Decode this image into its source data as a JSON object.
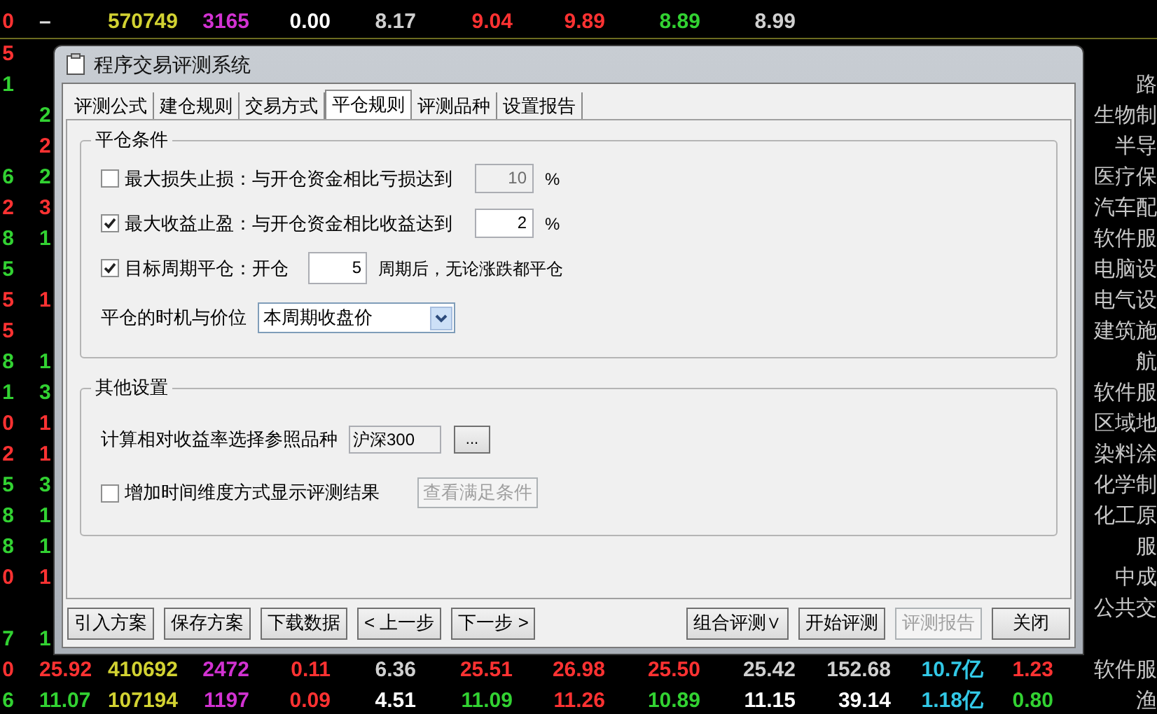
{
  "market_rows": [
    {
      "cells": [
        {
          "text": "0",
          "color": "#ff3232"
        },
        {
          "text": "–",
          "color": "#e0e0e0"
        },
        {
          "text": "570749",
          "color": "#d2d232"
        },
        {
          "text": "3165",
          "color": "#d232d2"
        },
        {
          "text": "0.00",
          "color": "#ffffff"
        },
        {
          "text": "8.17",
          "color": "#d0d0d0"
        },
        {
          "text": "9.04",
          "color": "#ff3232"
        },
        {
          "text": "9.89",
          "color": "#ff3232"
        },
        {
          "text": "8.89",
          "color": "#32d232"
        },
        {
          "text": "8.99",
          "color": "#d0d0d0"
        }
      ]
    },
    {
      "cells": [
        {
          "text": "5",
          "color": "#ff3232"
        }
      ]
    },
    {
      "cells": [
        {
          "text": "1",
          "color": "#32d232"
        }
      ],
      "sector": "路"
    },
    {
      "cells": [
        null,
        {
          "text": "2",
          "color": "#32d232"
        }
      ],
      "sector": "生物制"
    },
    {
      "cells": [
        null,
        {
          "text": "2",
          "color": "#ff3232"
        }
      ],
      "sector": "半导"
    },
    {
      "cells": [
        {
          "text": "6",
          "color": "#32d232"
        },
        {
          "text": "2",
          "color": "#32d232"
        }
      ],
      "sector": "医疗保"
    },
    {
      "cells": [
        {
          "text": "2",
          "color": "#ff3232"
        },
        {
          "text": "3",
          "color": "#ff3232"
        }
      ],
      "sector": "汽车配"
    },
    {
      "cells": [
        {
          "text": "8",
          "color": "#32d232"
        },
        {
          "text": "1",
          "color": "#32d232"
        }
      ],
      "sector": "软件服"
    },
    {
      "cells": [
        {
          "text": "5",
          "color": "#32d232"
        }
      ],
      "sector": "电脑设"
    },
    {
      "cells": [
        {
          "text": "5",
          "color": "#ff3232"
        },
        {
          "text": "1",
          "color": "#ff3232"
        }
      ],
      "sector": "电气设"
    },
    {
      "cells": [
        {
          "text": "5",
          "color": "#ff3232"
        }
      ],
      "sector": "建筑施"
    },
    {
      "cells": [
        {
          "text": "8",
          "color": "#32d232"
        },
        {
          "text": "1",
          "color": "#32d232"
        }
      ],
      "sector": "航"
    },
    {
      "cells": [
        {
          "text": "1",
          "color": "#32d232"
        },
        {
          "text": "3",
          "color": "#32d232"
        }
      ],
      "sector": "软件服"
    },
    {
      "cells": [
        {
          "text": "0",
          "color": "#ff3232"
        },
        {
          "text": "1",
          "color": "#ff3232"
        }
      ],
      "sector": "区域地"
    },
    {
      "cells": [
        {
          "text": "2",
          "color": "#ff3232"
        },
        {
          "text": "1",
          "color": "#ff3232"
        }
      ],
      "sector": "染料涂"
    },
    {
      "cells": [
        {
          "text": "5",
          "color": "#32d232"
        },
        {
          "text": "3",
          "color": "#32d232"
        }
      ],
      "sector": "化学制"
    },
    {
      "cells": [
        {
          "text": "8",
          "color": "#32d232"
        },
        {
          "text": "1",
          "color": "#32d232"
        }
      ],
      "sector": "化工原"
    },
    {
      "cells": [
        {
          "text": "8",
          "color": "#32d232"
        },
        {
          "text": "1",
          "color": "#32d232"
        }
      ],
      "sector": "服"
    },
    {
      "cells": [
        {
          "text": "0",
          "color": "#ff3232"
        },
        {
          "text": "1",
          "color": "#ff3232"
        }
      ],
      "sector": "中成"
    },
    {
      "cells": [],
      "sector": "公共交"
    },
    {
      "cells": [
        {
          "text": "7",
          "color": "#32d232"
        },
        {
          "text": "1",
          "color": "#32d232"
        }
      ]
    },
    {
      "cells": [
        {
          "text": "0",
          "color": "#ff3232"
        },
        {
          "text": "25.92",
          "color": "#ff3232"
        },
        {
          "text": "410692",
          "color": "#d2d232"
        },
        {
          "text": "2472",
          "color": "#d232d2"
        },
        {
          "text": "0.11",
          "color": "#ff3232"
        },
        {
          "text": "6.36",
          "color": "#d0d0d0"
        },
        {
          "text": "25.51",
          "color": "#ff3232"
        },
        {
          "text": "26.98",
          "color": "#ff3232"
        },
        {
          "text": "25.50",
          "color": "#ff3232"
        },
        {
          "text": "25.42",
          "color": "#d0d0d0"
        },
        {
          "text": "152.68",
          "color": "#d0d0d0"
        },
        {
          "text": "10.7亿",
          "color": "#32c8e6"
        },
        {
          "text": "1.23",
          "color": "#ff3232"
        }
      ],
      "sector": "软件服"
    },
    {
      "cells": [
        {
          "text": "6",
          "color": "#32d232"
        },
        {
          "text": "11.07",
          "color": "#32d232"
        },
        {
          "text": "107194",
          "color": "#d2d232"
        },
        {
          "text": "1197",
          "color": "#d232d2"
        },
        {
          "text": "0.09",
          "color": "#ff3232"
        },
        {
          "text": "4.51",
          "color": "#ffffff"
        },
        {
          "text": "11.09",
          "color": "#32d232"
        },
        {
          "text": "11.26",
          "color": "#ff3232"
        },
        {
          "text": "10.89",
          "color": "#32d232"
        },
        {
          "text": "11.15",
          "color": "#ffffff"
        },
        {
          "text": "39.14",
          "color": "#ffffff"
        },
        {
          "text": "1.18亿",
          "color": "#32c8e6"
        },
        {
          "text": "0.80",
          "color": "#32d232"
        }
      ],
      "sector": "渔"
    }
  ],
  "dialog": {
    "title": "程序交易评测系统",
    "tabs": [
      {
        "label": "评测公式",
        "selected": false
      },
      {
        "label": "建仓规则",
        "selected": false
      },
      {
        "label": "交易方式",
        "selected": false
      },
      {
        "label": "平仓规则",
        "selected": true
      },
      {
        "label": "评测品种",
        "selected": false
      },
      {
        "label": "设置报告",
        "selected": false
      }
    ],
    "close_conditions": {
      "title": "平仓条件",
      "rows": [
        {
          "kind": "input",
          "checked": false,
          "label": "最大损失止损：与开仓资金相比亏损达到",
          "value": "10",
          "suffix": "%"
        },
        {
          "kind": "input",
          "checked": true,
          "label": "最大收益止盈：与开仓资金相比收益达到",
          "value": "2",
          "suffix": "%"
        },
        {
          "kind": "spinner",
          "checked": true,
          "label": "目标周期平仓：开仓",
          "value": "5",
          "suffix": "周期后，无论涨跌都平仓"
        }
      ],
      "timing": {
        "label": "平仓的时机与价位",
        "value": "本周期收盘价"
      }
    },
    "other_settings": {
      "title": "其他设置",
      "reference": {
        "label": "计算相对收益率选择参照品种",
        "value": "沪深300",
        "button": "..."
      },
      "time_dimension": {
        "checked": false,
        "label": "增加时间维度方式显示评测结果",
        "button": "查看满足条件",
        "button_disabled": true
      }
    },
    "buttons_left": [
      {
        "label": "引入方案",
        "disabled": false
      },
      {
        "label": "保存方案",
        "disabled": false
      },
      {
        "label": "下载数据",
        "disabled": false
      },
      {
        "label": "< 上一步",
        "disabled": false
      },
      {
        "label": "下一步 >",
        "disabled": false
      }
    ],
    "buttons_right": [
      {
        "label": "组合评测∨",
        "disabled": false
      },
      {
        "label": "开始评测",
        "disabled": false
      },
      {
        "label": "评测报告",
        "disabled": true
      },
      {
        "label": "关闭",
        "disabled": false
      }
    ]
  }
}
